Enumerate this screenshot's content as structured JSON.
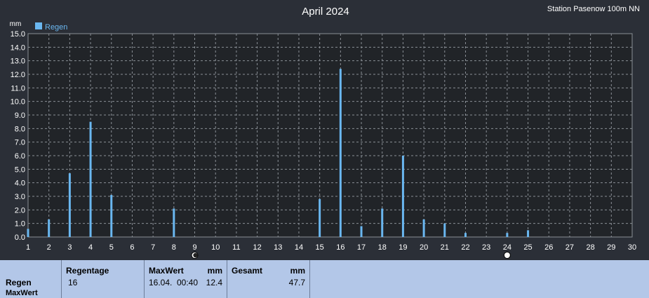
{
  "header": {
    "title": "April 2024",
    "station": "Station Pasenow 100m NN",
    "unit": "mm"
  },
  "chart_data": {
    "type": "bar",
    "title": "April 2024",
    "ylabel": "mm",
    "ylim": [
      0,
      15
    ],
    "xlim": [
      1,
      30
    ],
    "grid": true,
    "legend": {
      "position": "top-left",
      "entries": [
        "Regen"
      ]
    },
    "series": [
      {
        "name": "Regen",
        "color": "#6ab7f0",
        "points": [
          {
            "x": 1,
            "y": 0.6
          },
          {
            "x": 2,
            "y": 1.3
          },
          {
            "x": 3,
            "y": 4.7
          },
          {
            "x": 4,
            "y": 8.5
          },
          {
            "x": 5,
            "y": 3.1
          },
          {
            "x": 8,
            "y": 2.1
          },
          {
            "x": 15,
            "y": 2.8
          },
          {
            "x": 16,
            "y": 12.4
          },
          {
            "x": 17,
            "y": 0.8
          },
          {
            "x": 18,
            "y": 2.1
          },
          {
            "x": 19,
            "y": 6.0
          },
          {
            "x": 20,
            "y": 1.3
          },
          {
            "x": 21,
            "y": 1.0
          },
          {
            "x": 22,
            "y": 0.3
          },
          {
            "x": 24,
            "y": 0.3
          },
          {
            "x": 25,
            "y": 0.5
          }
        ]
      }
    ],
    "y_ticks": [
      "0.0",
      "1.0",
      "2.0",
      "3.0",
      "4.0",
      "5.0",
      "6.0",
      "7.0",
      "8.0",
      "9.0",
      "10.0",
      "11.0",
      "12.0",
      "13.0",
      "14.0",
      "15.0"
    ],
    "x_ticks": [
      "1",
      "2",
      "3",
      "4",
      "5",
      "6",
      "7",
      "8",
      "9",
      "10",
      "11",
      "12",
      "13",
      "14",
      "15",
      "16",
      "17",
      "18",
      "19",
      "20",
      "21",
      "22",
      "23",
      "24",
      "25",
      "26",
      "27",
      "28",
      "29",
      "30"
    ],
    "moon_phases": [
      {
        "day": 9,
        "phase": "new-moon"
      },
      {
        "day": 24,
        "phase": "full-moon"
      }
    ]
  },
  "summary": {
    "row_label": "Regen",
    "row_sublabel": "MaxWert",
    "regentage_label": "Regentage",
    "regentage_value": "16",
    "maxwert_label": "MaxWert",
    "maxwert_unit": "mm",
    "maxwert_date": "16.04.",
    "maxwert_time": "00:40",
    "maxwert_value": "12.4",
    "gesamt_label": "Gesamt",
    "gesamt_unit": "mm",
    "gesamt_value": "47.7"
  },
  "colors": {
    "background": "#2b2f37",
    "plot_background": "#212428",
    "grid": "#8a8f96",
    "bar": "#6ab7f0",
    "summary_background": "#b3c7e8"
  }
}
